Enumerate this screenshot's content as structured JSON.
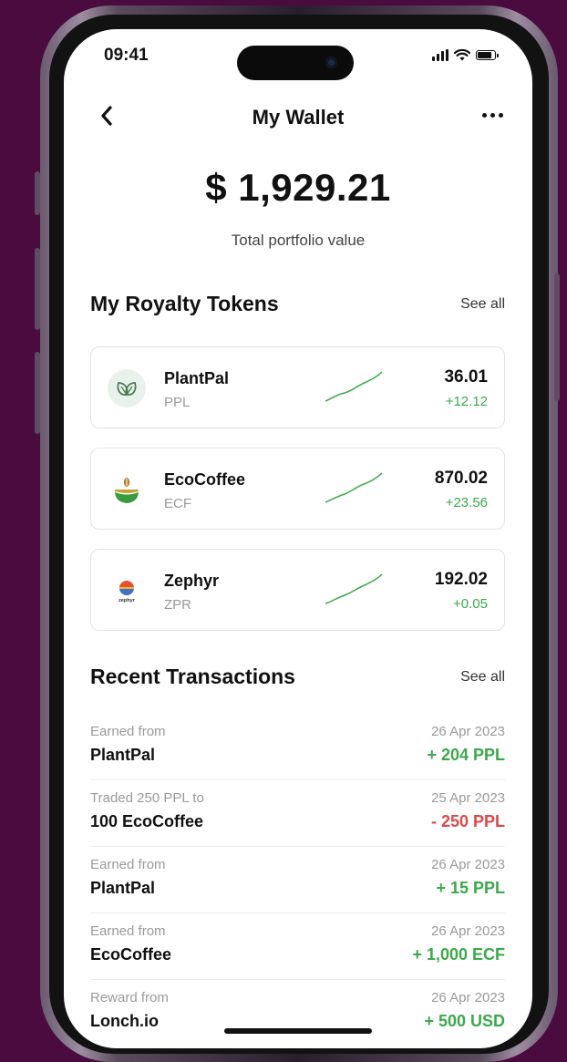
{
  "status_bar": {
    "time": "09:41"
  },
  "nav": {
    "title": "My Wallet"
  },
  "portfolio": {
    "value": "$ 1,929.21",
    "caption": "Total portfolio value"
  },
  "tokens_section": {
    "title": "My Royalty Tokens",
    "see_all": "See all"
  },
  "tokens": [
    {
      "name": "PlantPal",
      "symbol": "PPL",
      "value": "36.01",
      "change": "+12.12",
      "icon": "plant-leaves-icon"
    },
    {
      "name": "EcoCoffee",
      "symbol": "ECF",
      "value": "870.02",
      "change": "+23.56",
      "icon": "coffee-bowl-icon"
    },
    {
      "name": "Zephyr",
      "symbol": "ZPR",
      "value": "192.02",
      "change": "+0.05",
      "icon": "zephyr-sun-icon",
      "logo_text": "zephyr"
    }
  ],
  "transactions_section": {
    "title": "Recent Transactions",
    "see_all": "See all"
  },
  "transactions": [
    {
      "label": "Earned from",
      "party": "PlantPal",
      "date": "26 Apr 2023",
      "amount": "+ 204 PPL",
      "direction": "in"
    },
    {
      "label": "Traded 250 PPL to",
      "party": "100 EcoCoffee",
      "date": "25 Apr 2023",
      "amount": "- 250 PPL",
      "direction": "out"
    },
    {
      "label": "Earned from",
      "party": "PlantPal",
      "date": "26 Apr 2023",
      "amount": "+ 15 PPL",
      "direction": "in"
    },
    {
      "label": "Earned from",
      "party": "EcoCoffee",
      "date": "26 Apr 2023",
      "amount": "+ 1,000 ECF",
      "direction": "in"
    },
    {
      "label": "Reward from",
      "party": "Lonch.io",
      "date": "26 Apr 2023",
      "amount": "+ 500 USD",
      "direction": "in"
    }
  ],
  "colors": {
    "background": "#4a0b3f",
    "positive": "#3aaa4a",
    "negative": "#e04848",
    "sparkline": "#3aaa4a"
  }
}
